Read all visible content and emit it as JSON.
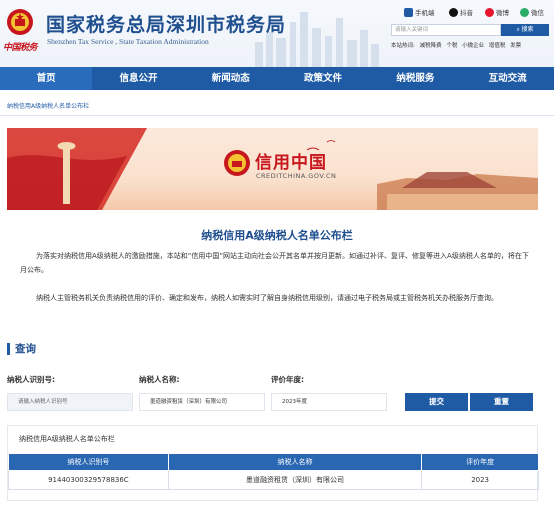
{
  "header": {
    "site_title": "国家税务总局深圳市税务局",
    "site_title_en": "Shenzhen Tax Service , State Taxation Administration",
    "calligraphy": "中国税务",
    "social": [
      {
        "label": "手机端",
        "icon": "mobile-icon",
        "color": "#1f5ba5"
      },
      {
        "label": "抖音",
        "icon": "douyin-icon",
        "color": "#111111"
      },
      {
        "label": "微博",
        "icon": "weibo-icon",
        "color": "#e6162d"
      },
      {
        "label": "微信",
        "icon": "wechat-icon",
        "color": "#2aae67"
      }
    ],
    "search_placeholder": "请输入关键词",
    "search_button": "搜索",
    "hot_label": "本站热词:",
    "hot_words": [
      "减税降费",
      "个税",
      "小微企业",
      "增值税",
      "发票"
    ]
  },
  "nav": {
    "items": [
      "首页",
      "信息公开",
      "新闻动态",
      "政策文件",
      "纳税服务",
      "互动交流"
    ]
  },
  "breadcrumb": "纳税信用A级纳税人名单公布栏",
  "banner": {
    "logo_text": "信用中国",
    "logo_sub": "CREDITCHINA.GOV.CN"
  },
  "page_title": "纳税信用A级纳税人名单公布栏",
  "paragraphs": [
    "为落实对纳税信用A级纳税人的激励措施，本站和“信用中国”网站主动向社会公开其名单并按月更新。如通过补评、复评、修复等进入A级纳税人名单的，将在下月公布。",
    "纳税人主管税务机关负责纳税信用的评价、确定和发布，纳税人如需实时了解自身纳税信用级别，请通过电子税务局或主管税务机关办税服务厅查询。"
  ],
  "query": {
    "section_title": "查询",
    "id_label": "纳税人识别号:",
    "id_placeholder": "请输入纳税人识别号",
    "name_label": "纳税人名称:",
    "name_value": "墨道融资租赁（深圳）有限公司",
    "year_label": "评价年度:",
    "year_value": "2023年度",
    "submit": "提交",
    "reset": "重置"
  },
  "results": {
    "title": "纳税信用A级纳税人名单公布栏",
    "columns": [
      "纳税人识别号",
      "纳税人名称",
      "评价年度"
    ],
    "rows": [
      [
        "91440300329578836C",
        "墨道融资租赁（深圳）有限公司",
        "2023"
      ]
    ]
  },
  "colors": {
    "primary": "#1f5ba5",
    "title": "#1f4f8f",
    "brand_red": "#c8161d"
  }
}
